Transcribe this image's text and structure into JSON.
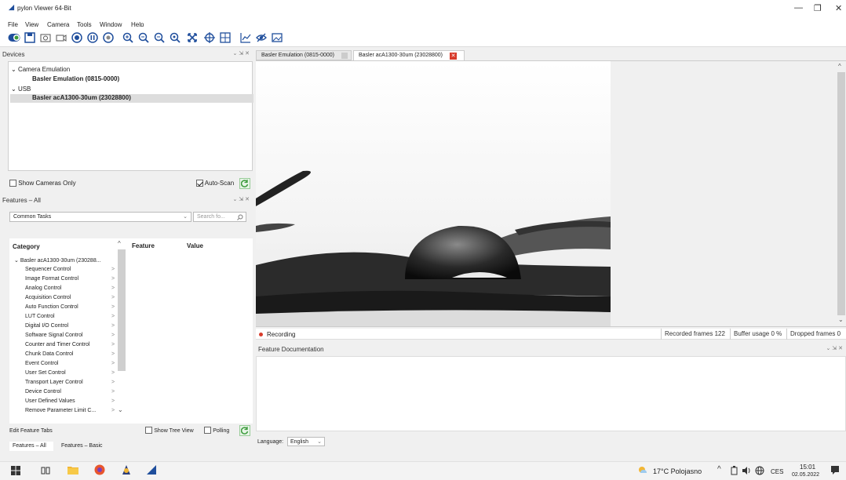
{
  "window": {
    "title": "pylon Viewer 64-Bit",
    "minimize": "—",
    "maximize": "❐",
    "close": "✕"
  },
  "menu": [
    "File",
    "View",
    "Camera",
    "Tools",
    "Window",
    "Help"
  ],
  "devices": {
    "title": "Devices",
    "groups": [
      {
        "label": "Camera Emulation",
        "items": [
          "Basler Emulation (0815-0000)"
        ]
      },
      {
        "label": "USB",
        "items": [
          "Basler acA1300-30um (23028800)"
        ]
      }
    ],
    "show_cameras_only": "Show Cameras Only",
    "auto_scan": "Auto-Scan"
  },
  "features": {
    "title": "Features – All",
    "dropdown_value": "Common Tasks",
    "search_placeholder": "Search fo...",
    "col_category": "Category",
    "col_feature": "Feature",
    "col_value": "Value",
    "root": "Basler acA1300-30um (230288...",
    "categories": [
      "Sequencer Control",
      "Image Format Control",
      "Analog Control",
      "Acquisition Control",
      "Auto Function Control",
      "LUT Control",
      "Digital I/O Control",
      "Software Signal Control",
      "Counter and Timer Control",
      "Chunk Data Control",
      "Event Control",
      "User Set Control",
      "Transport Layer Control",
      "Device Control",
      "User Defined Values",
      "Remove Parameter Limit C..."
    ],
    "edit_tabs": "Edit Feature Tabs",
    "show_tree_view": "Show Tree View",
    "polling": "Polling",
    "tabs": [
      "Features – All",
      "Features – Basic"
    ]
  },
  "image_tabs": [
    {
      "label": "Basler Emulation (0815-0000)",
      "active": false
    },
    {
      "label": "Basler acA1300-30um (23028800)",
      "active": true
    }
  ],
  "status": {
    "recording": "Recording",
    "recorded_frames": "Recorded frames 122",
    "buffer_usage": "Buffer usage 0 %",
    "dropped_frames": "Dropped frames 0"
  },
  "doc": {
    "title": "Feature Documentation",
    "language_label": "Language:",
    "language_value": "English"
  },
  "taskbar": {
    "weather": "17°C Polojasno",
    "lang": "CES",
    "time": "15:01",
    "date": "02.05.2022"
  },
  "colors": {
    "accent_red": "#d83b2b",
    "refresh_green": "#3a9a3a",
    "toolbar_blue": "#1f4e9c"
  }
}
